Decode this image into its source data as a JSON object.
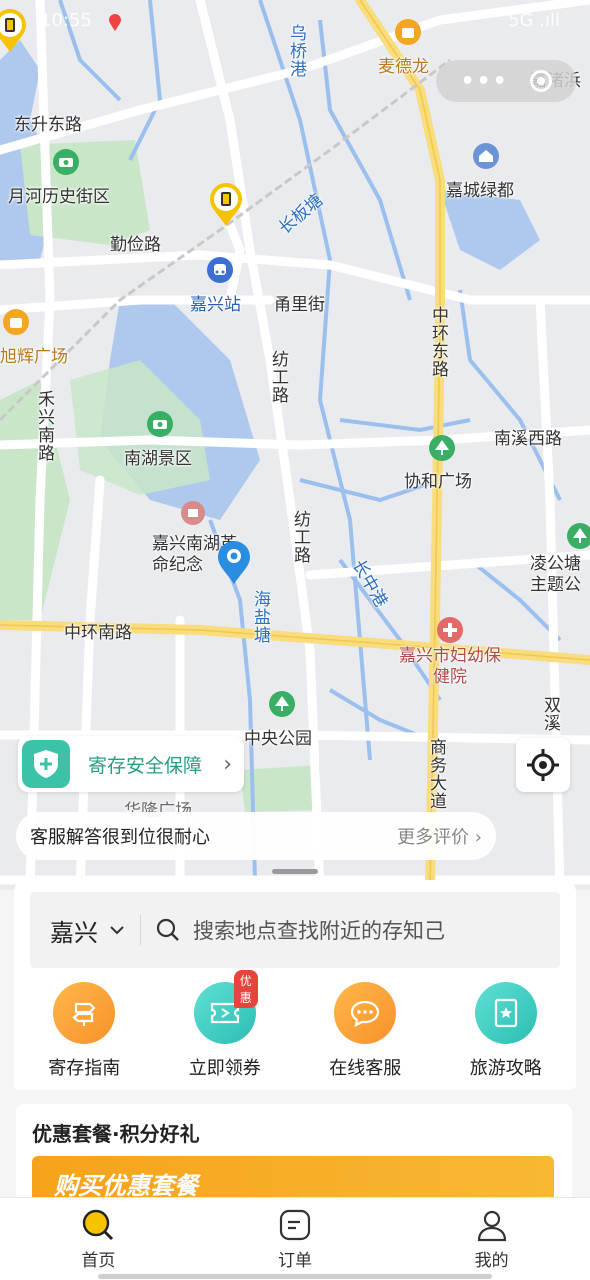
{
  "status_bar": {
    "time": "10:55",
    "signal": "5G .ıll"
  },
  "map": {
    "labels": {
      "wuqiao_gang": "乌桥港",
      "maidelong": "麦德龙",
      "dongsheng_east_rd": "东升东路",
      "jiazhu_bang": "嘉渚浜",
      "yuehe_street": "月河历史街区",
      "jiacheng_lvdu": "嘉城绿都",
      "changban_tang": "长板塘",
      "qinjian_rd": "勤俭路",
      "jiaxing_station": "嘉兴站",
      "yongli_street": "甬里街",
      "xuhui_plaza": "旭辉广场",
      "zhonghuan_east_rd": "中环东路",
      "fanggong_rd_1": "纺工路",
      "hexing_south_rd": "禾兴南路",
      "nanxi_west_rd": "南溪西路",
      "nanhu_scenic": "南湖景区",
      "xiehe_plaza": "协和广场",
      "fanggong_rd_2": "纺工路",
      "nanhu_memorial": "嘉兴南湖革命纪念",
      "linggong_tang": "凌公塘主题公",
      "changzhong_gang": "长中港",
      "haiyan_tang": "海盐塘",
      "zhonghuan_south_rd": "中环南路",
      "maternity_hospital": "嘉兴市妇幼保健院",
      "shuangxi": "双溪",
      "central_park": "中央公园",
      "shangwu_ave": "商务大道",
      "hualong_plaza": "华隆广场"
    },
    "safety_badge": "寄存安全保障",
    "review_text": "客服解答很到位很耐心",
    "more_reviews": "更多评价"
  },
  "panel": {
    "city": "嘉兴",
    "search_placeholder": "搜索地点查找附近的存知己",
    "quick_actions": [
      {
        "label": "寄存指南",
        "icon": "signpost-icon"
      },
      {
        "label": "立即领券",
        "icon": "coupon-icon",
        "tag": "优惠"
      },
      {
        "label": "在线客服",
        "icon": "chat-icon"
      },
      {
        "label": "旅游攻略",
        "icon": "guidebook-icon"
      }
    ]
  },
  "promo": {
    "title": "优惠套餐·积分好礼",
    "banner": "购买优惠套餐"
  },
  "tabbar": {
    "home": "首页",
    "orders": "订单",
    "mine": "我的"
  },
  "colors": {
    "accent": "#f5c300",
    "teal": "#3cc2a6",
    "orange": "#f7922a"
  }
}
